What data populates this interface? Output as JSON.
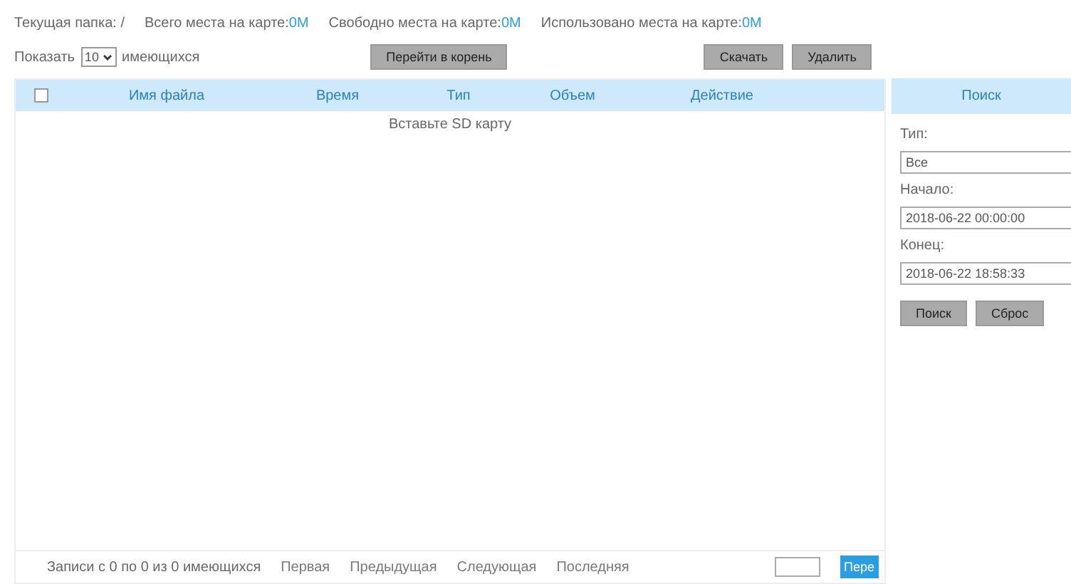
{
  "info_bar": {
    "current_folder_label": "Текущая папка:",
    "current_folder": "/",
    "stats": [
      {
        "label": "Всего места на карте:",
        "value": "0M"
      },
      {
        "label": "Свободно места на карте:",
        "value": "0M"
      },
      {
        "label": "Использовано места на карте:",
        "value": "0M"
      }
    ]
  },
  "toolbar": {
    "show_label": "Показать",
    "page_size": "10",
    "show_suffix": "имеющихся",
    "root_button": "Перейти в корень",
    "buttons": [
      "Скачать",
      "Удалить"
    ]
  },
  "table": {
    "select_all_checked": false,
    "columns": [
      "Имя файла",
      "Время",
      "Тип",
      "Объем",
      "Действие"
    ],
    "empty_message": "Вставьте SD карту"
  },
  "pager": {
    "summary": "Записи с 0 по 0 из 0 имеющихся",
    "links": [
      "Первая",
      "Предыдущая",
      "Следующая",
      "Последняя"
    ],
    "go_button": "Пере"
  },
  "search_panel": {
    "title": "Поиск",
    "type_label": "Тип:",
    "type_value": "Все",
    "start_label": "Начало:",
    "start_value": "2018-06-22 00:00:00",
    "end_label": "Конец:",
    "end_value": "2018-06-22 18:58:33",
    "buttons": [
      "Поиск",
      "Сброс"
    ]
  }
}
